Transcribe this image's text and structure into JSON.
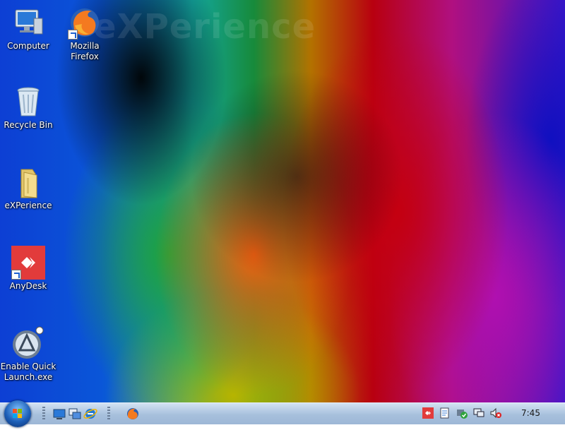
{
  "wallpaper": {
    "text": "eXPerience"
  },
  "desktop": {
    "icons": [
      {
        "label": "Computer",
        "icon": "computer-icon"
      },
      {
        "label": "Mozilla Firefox",
        "icon": "firefox-icon"
      },
      {
        "label": "Recycle Bin",
        "icon": "recycle-bin-icon"
      },
      {
        "label": "eXPerience",
        "icon": "folder-icon"
      },
      {
        "label": "AnyDesk",
        "icon": "anydesk-icon"
      },
      {
        "label": "Enable Quick Launch.exe",
        "icon": "quick-launch-icon"
      }
    ]
  },
  "taskbar": {
    "clock": "7:45",
    "quick_launch": [
      "show-desktop-icon",
      "switch-windows-icon",
      "internet-explorer-icon"
    ],
    "running": [
      "firefox-icon"
    ],
    "tray": [
      "anydesk-tray-icon",
      "document-tray-icon",
      "security-tray-icon",
      "network-tray-icon",
      "volume-muted-icon"
    ]
  },
  "colors": {
    "taskbar": "#a7c0dc",
    "anydesk": "#e23b3b",
    "firefox": "#f47a20"
  }
}
